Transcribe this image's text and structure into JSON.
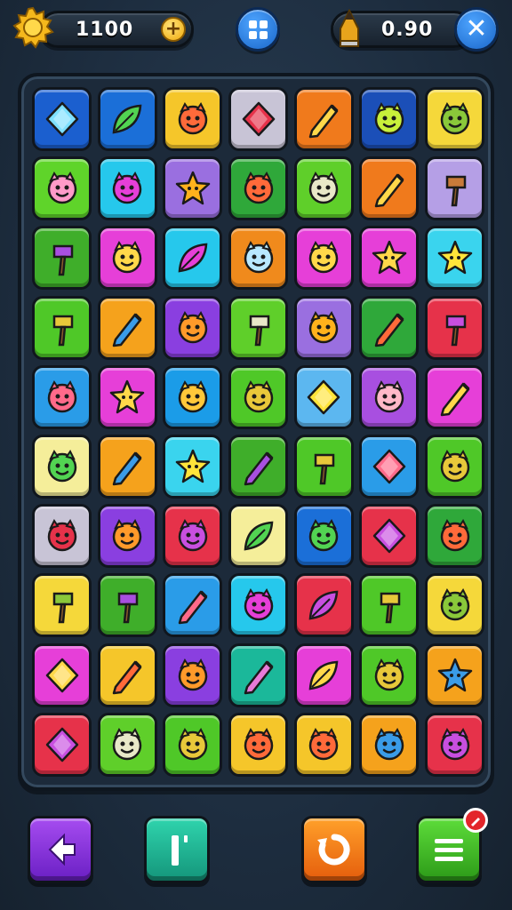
{
  "hud": {
    "coins": "1100",
    "coins_icon": "gear-coin-icon",
    "gems": "0.90",
    "gems_icon": "pencil-icon",
    "add_icon": "plus-icon",
    "grid_icon": "grid-menu-icon",
    "close_icon": "close-icon"
  },
  "board": {
    "rows": 10,
    "cols": 7,
    "tiles": [
      {
        "bg": "#1b5fcf",
        "icon": "diamond"
      },
      {
        "bg": "#1b6fd8",
        "icon": "leaf"
      },
      {
        "bg": "#f5c62a",
        "icon": "face"
      },
      {
        "bg": "#c8c4d6",
        "icon": "diamond"
      },
      {
        "bg": "#f07a1c",
        "icon": "pencil"
      },
      {
        "bg": "#1b4fb8",
        "icon": "face"
      },
      {
        "bg": "#f5d83a",
        "icon": "face"
      },
      {
        "bg": "#5fd42a",
        "icon": "face"
      },
      {
        "bg": "#26c8ec",
        "icon": "face"
      },
      {
        "bg": "#9a6fe0",
        "icon": "star"
      },
      {
        "bg": "#2fa83a",
        "icon": "face"
      },
      {
        "bg": "#5fcf2a",
        "icon": "face"
      },
      {
        "bg": "#f07a1c",
        "icon": "pencil"
      },
      {
        "bg": "#b59fe6",
        "icon": "hammer"
      },
      {
        "bg": "#3fae2a",
        "icon": "hammer"
      },
      {
        "bg": "#e63fd8",
        "icon": "face"
      },
      {
        "bg": "#26c8ec",
        "icon": "leaf"
      },
      {
        "bg": "#f08a1c",
        "icon": "face"
      },
      {
        "bg": "#e63fd8",
        "icon": "face"
      },
      {
        "bg": "#e63fd8",
        "icon": "star"
      },
      {
        "bg": "#3ad4ee",
        "icon": "star"
      },
      {
        "bg": "#4fc828",
        "icon": "hammer"
      },
      {
        "bg": "#f5a21c",
        "icon": "pencil"
      },
      {
        "bg": "#8a3fe0",
        "icon": "face"
      },
      {
        "bg": "#5fcf2a",
        "icon": "hammer"
      },
      {
        "bg": "#9a6fe0",
        "icon": "face"
      },
      {
        "bg": "#2fa83a",
        "icon": "pencil"
      },
      {
        "bg": "#e6324a",
        "icon": "hammer"
      },
      {
        "bg": "#2a9ce8",
        "icon": "face"
      },
      {
        "bg": "#e63fd8",
        "icon": "star"
      },
      {
        "bg": "#1b9ce8",
        "icon": "face"
      },
      {
        "bg": "#4fc828",
        "icon": "face"
      },
      {
        "bg": "#5cb7f0",
        "icon": "diamond"
      },
      {
        "bg": "#a84fe0",
        "icon": "face"
      },
      {
        "bg": "#e63fd8",
        "icon": "pencil"
      },
      {
        "bg": "#f5ee9a",
        "icon": "face"
      },
      {
        "bg": "#f5a21c",
        "icon": "pencil"
      },
      {
        "bg": "#3ad4ee",
        "icon": "star"
      },
      {
        "bg": "#3fae2a",
        "icon": "pencil"
      },
      {
        "bg": "#4fc828",
        "icon": "hammer"
      },
      {
        "bg": "#2a9ce8",
        "icon": "diamond"
      },
      {
        "bg": "#4fc828",
        "icon": "face"
      },
      {
        "bg": "#c8c4d6",
        "icon": "face"
      },
      {
        "bg": "#8a3fe0",
        "icon": "face"
      },
      {
        "bg": "#e6324a",
        "icon": "face"
      },
      {
        "bg": "#f5ee9a",
        "icon": "leaf"
      },
      {
        "bg": "#1b6fd8",
        "icon": "face"
      },
      {
        "bg": "#e6324a",
        "icon": "diamond"
      },
      {
        "bg": "#2fa83a",
        "icon": "face"
      },
      {
        "bg": "#f5d83a",
        "icon": "hammer"
      },
      {
        "bg": "#3fae2a",
        "icon": "hammer"
      },
      {
        "bg": "#2a9ce8",
        "icon": "pencil"
      },
      {
        "bg": "#26c8ec",
        "icon": "face"
      },
      {
        "bg": "#e6324a",
        "icon": "leaf"
      },
      {
        "bg": "#4fc828",
        "icon": "hammer"
      },
      {
        "bg": "#f5d83a",
        "icon": "face"
      },
      {
        "bg": "#e63fd8",
        "icon": "diamond"
      },
      {
        "bg": "#f5c62a",
        "icon": "pencil"
      },
      {
        "bg": "#8a3fe0",
        "icon": "face"
      },
      {
        "bg": "#1bb89a",
        "icon": "pencil"
      },
      {
        "bg": "#e63fd8",
        "icon": "leaf"
      },
      {
        "bg": "#4fc828",
        "icon": "face"
      },
      {
        "bg": "#f5a21c",
        "icon": "star"
      },
      {
        "bg": "#e6324a",
        "icon": "diamond"
      },
      {
        "bg": "#5fcf2a",
        "icon": "face"
      },
      {
        "bg": "#4fc828",
        "icon": "face"
      },
      {
        "bg": "#f5c62a",
        "icon": "face"
      },
      {
        "bg": "#f5c62a",
        "icon": "face"
      },
      {
        "bg": "#f5a21c",
        "icon": "face"
      },
      {
        "bg": "#e6324a",
        "icon": "face"
      }
    ]
  },
  "controls": {
    "back_icon": "back-arrow-icon",
    "pause_icon": "pause-icon",
    "restart_icon": "restart-icon",
    "menu_icon": "menu-list-icon",
    "menu_badge_icon": "notification-icon"
  }
}
